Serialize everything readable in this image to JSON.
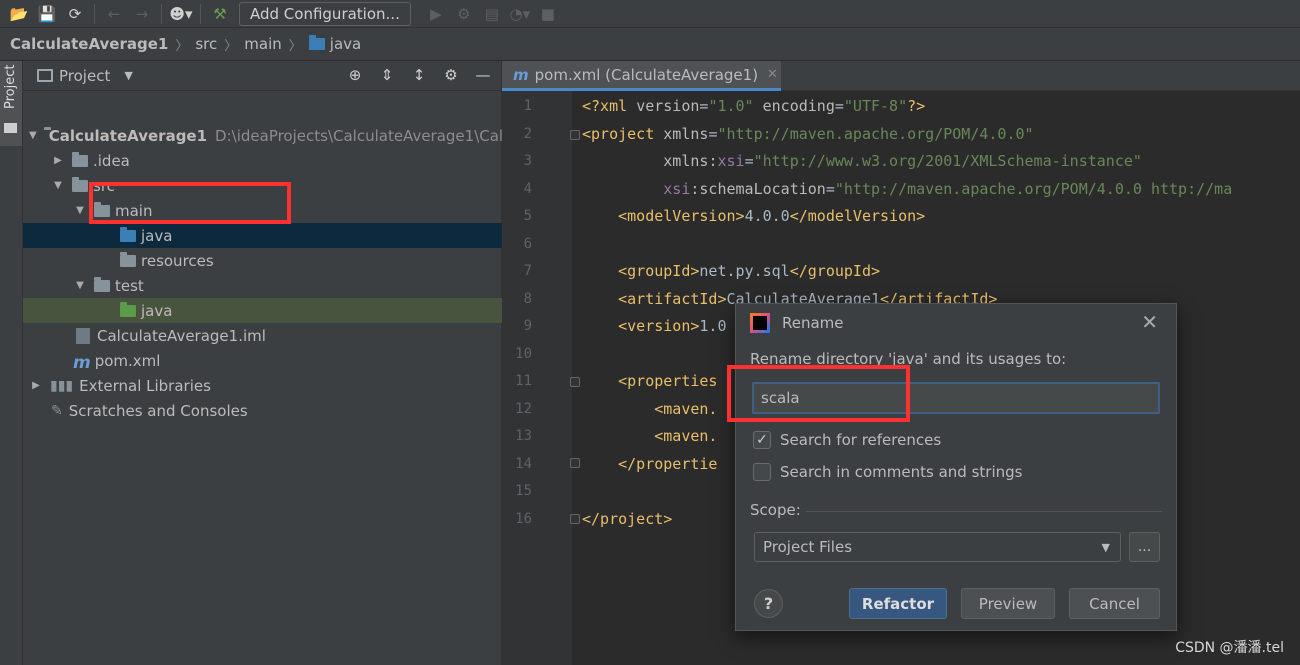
{
  "toolbar": {
    "add_config_label": "Add Configuration..."
  },
  "breadcrumb": {
    "project": "CalculateAverage1",
    "src": "src",
    "main": "main",
    "java": "java"
  },
  "stripe": {
    "label": "Project"
  },
  "project_panel": {
    "title": "Project",
    "tree": {
      "root_name": "CalculateAverage1",
      "root_path": "D:\\ideaProjects\\CalculateAverage1\\Cal",
      "idea": ".idea",
      "src": "src",
      "main": "main",
      "main_java": "java",
      "resources": "resources",
      "test": "test",
      "test_java": "java",
      "iml": "CalculateAverage1.iml",
      "pom": "pom.xml",
      "external_libraries": "External Libraries",
      "scratches": "Scratches and Consoles"
    }
  },
  "editor": {
    "tab_label": "pom.xml (CalculateAverage1)",
    "line_numbers": [
      "1",
      "2",
      "3",
      "4",
      "5",
      "6",
      "7",
      "8",
      "9",
      "10",
      "11",
      "12",
      "13",
      "14",
      "15",
      "16"
    ]
  },
  "rename_dialog": {
    "title": "Rename",
    "description": "Rename directory 'java' and its usages to:",
    "input_value": "scala",
    "search_references_label": "Search for references",
    "search_references_checked": true,
    "search_comments_label": "Search in comments and strings",
    "search_comments_checked": false,
    "scope_label": "Scope:",
    "scope_value": "Project Files",
    "more_label": "...",
    "help_label": "?",
    "refactor_label": "Refactor",
    "preview_label": "Preview",
    "cancel_label": "Cancel"
  },
  "watermark": "CSDN @潘潘.tel",
  "colors": {
    "accent": "#4a88c7",
    "annotation": "#ff3030",
    "selection": "#0d293e"
  }
}
